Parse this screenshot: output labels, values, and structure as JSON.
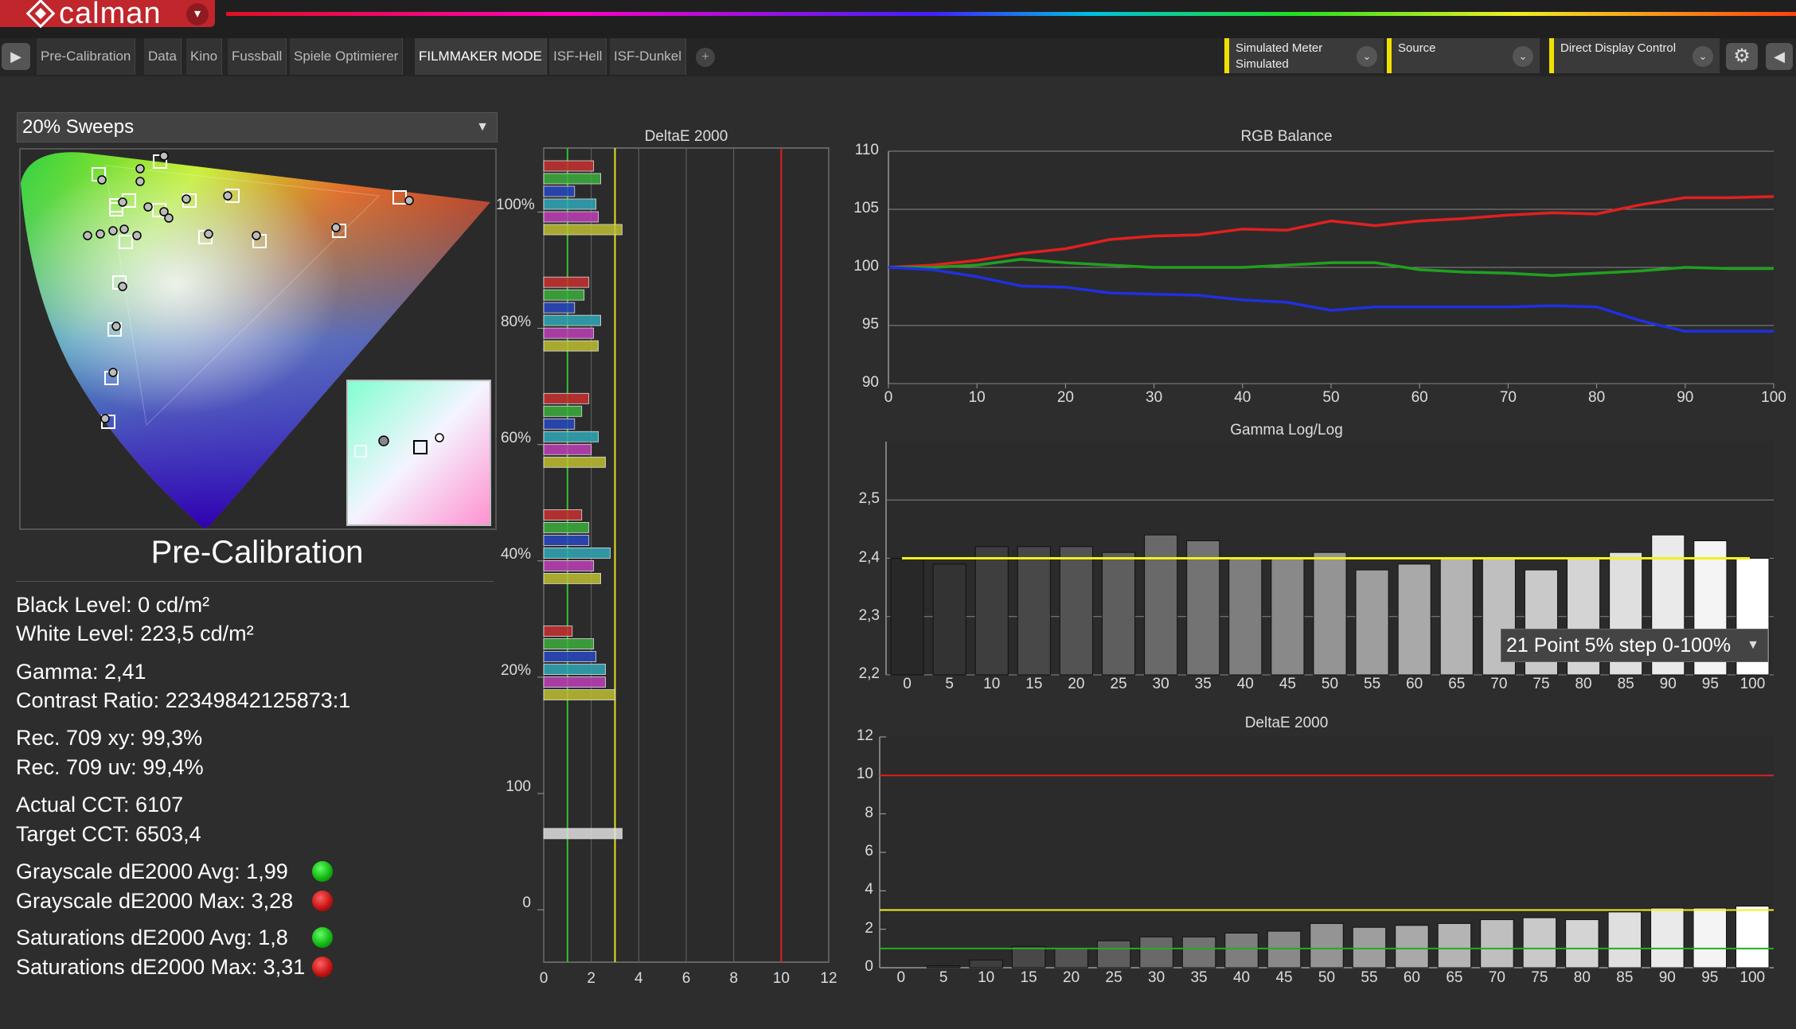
{
  "app": {
    "name": "calman",
    "logo_dropdown": "▾"
  },
  "nav": {
    "left_arrow": "▶",
    "tabs": [
      {
        "label": "Pre-Calibration",
        "active": false
      },
      {
        "label": "Data",
        "active": false
      },
      {
        "label": "Kino",
        "active": false
      },
      {
        "label": "Fussball",
        "active": false
      },
      {
        "label": "Spiele Optimierer",
        "active": false
      },
      {
        "label": "FILMMAKER MODE",
        "active": true
      },
      {
        "label": "ISF-Hell",
        "active": false
      },
      {
        "label": "ISF-Dunkel",
        "active": false
      }
    ],
    "add_tab": "+",
    "meter": {
      "line1": "Simulated Meter",
      "line2": "Simulated"
    },
    "source": {
      "line1": "Source",
      "line2": ""
    },
    "display": {
      "line1": "Direct Display Control",
      "line2": ""
    },
    "chevron": "⌄",
    "gear": "⚙",
    "back_arrow": "◀"
  },
  "left": {
    "sweep_select": "20% Sweeps",
    "caret": "▼",
    "title": "Pre-Calibration",
    "stats": {
      "black_level": "Black Level: 0 cd/m²",
      "white_level": "White Level: 223,5 cd/m²",
      "gamma": "Gamma: 2,41",
      "contrast": "Contrast Ratio: 22349842125873:1",
      "rec709_xy": "Rec. 709 xy: 99,3%",
      "rec709_uv": "Rec. 709 uv: 99,4%",
      "actual_cct": "Actual CCT: 6107",
      "target_cct": "Target CCT: 6503,4",
      "gs_avg": "Grayscale dE2000 Avg: 1,99",
      "gs_max": "Grayscale dE2000 Max: 3,28",
      "sat_avg": "Saturations dE2000 Avg: 1,8",
      "sat_max": "Saturations dE2000 Max: 3,31"
    },
    "status_colors": {
      "gs_avg": "green",
      "gs_max": "red",
      "sat_avg": "green",
      "sat_max": "red"
    }
  },
  "sat_chart": {
    "title": "DeltaE 2000",
    "groups": [
      {
        "label": "100%",
        "values": [
          2.1,
          2.4,
          1.3,
          2.2,
          2.3,
          3.3
        ]
      },
      {
        "label": "80%",
        "values": [
          1.9,
          1.7,
          1.3,
          2.4,
          2.1,
          2.3
        ]
      },
      {
        "label": "60%",
        "values": [
          1.9,
          1.6,
          1.3,
          2.3,
          2.0,
          2.6
        ]
      },
      {
        "label": "40%",
        "values": [
          1.6,
          1.9,
          1.9,
          2.8,
          2.1,
          2.4
        ]
      },
      {
        "label": "20%",
        "values": [
          1.2,
          2.1,
          2.2,
          2.6,
          2.6,
          3.0
        ]
      },
      {
        "label": "100",
        "values": [
          3.3
        ]
      },
      {
        "label": "0",
        "values": []
      }
    ],
    "bar_colors": [
      "#c83030",
      "#3cae3c",
      "#2848c0",
      "#30a8b8",
      "#c040b8",
      "#c0c030"
    ],
    "white_color": "#e0e0e0",
    "x_ticks": [
      "0",
      "2",
      "4",
      "6",
      "8",
      "10",
      "12"
    ],
    "xlim": [
      0,
      12
    ],
    "green_line": 1,
    "yellow_line": 3,
    "red_line": 10
  },
  "chart_data": [
    {
      "type": "line",
      "title": "RGB Balance",
      "x": [
        0,
        5,
        10,
        15,
        20,
        25,
        30,
        35,
        40,
        45,
        50,
        55,
        60,
        65,
        70,
        75,
        80,
        85,
        90,
        95,
        100
      ],
      "series": [
        {
          "color": "#e02020",
          "values": [
            100,
            100.2,
            100.6,
            101.2,
            101.6,
            102.4,
            102.7,
            102.8,
            103.3,
            103.2,
            104.0,
            103.6,
            104.0,
            104.2,
            104.5,
            104.7,
            104.6,
            105.4,
            106.0,
            106.0,
            106.1
          ]
        },
        {
          "color": "#20a020",
          "values": [
            100,
            100,
            100.2,
            100.7,
            100.4,
            100.2,
            100.0,
            100.0,
            100.0,
            100.2,
            100.4,
            100.4,
            99.8,
            99.6,
            99.5,
            99.3,
            99.5,
            99.7,
            100.0,
            99.9,
            99.9
          ]
        },
        {
          "color": "#2030e0",
          "values": [
            100,
            99.8,
            99.2,
            98.4,
            98.3,
            97.8,
            97.7,
            97.6,
            97.2,
            97.0,
            96.3,
            96.6,
            96.6,
            96.6,
            96.6,
            96.7,
            96.6,
            95.4,
            94.5,
            94.5,
            94.5
          ]
        }
      ],
      "ylim": [
        90,
        110
      ],
      "y_ticks": [
        "90",
        "95",
        "100",
        "105",
        "110"
      ],
      "x_ticks": [
        "0",
        "10",
        "20",
        "30",
        "40",
        "50",
        "60",
        "70",
        "80",
        "90",
        "100"
      ]
    },
    {
      "type": "bar",
      "title": "Gamma Log/Log",
      "categories": [
        "0",
        "5",
        "10",
        "15",
        "20",
        "25",
        "30",
        "35",
        "40",
        "45",
        "50",
        "55",
        "60",
        "65",
        "70",
        "75",
        "80",
        "85",
        "90",
        "95",
        "100"
      ],
      "values": [
        2.4,
        2.39,
        2.42,
        2.42,
        2.42,
        2.41,
        2.44,
        2.43,
        2.4,
        2.4,
        2.41,
        2.38,
        2.39,
        2.4,
        2.4,
        2.38,
        2.4,
        2.41,
        2.44,
        2.43,
        2.4
      ],
      "target": 2.4,
      "ylim": [
        2.2,
        2.6
      ],
      "y_ticks": [
        "2,2",
        "2,3",
        "2,4",
        "2,5"
      ],
      "range_select": "21 Point 5% step 0-100%"
    },
    {
      "type": "bar",
      "title": "DeltaE 2000",
      "categories": [
        "0",
        "5",
        "10",
        "15",
        "20",
        "25",
        "30",
        "35",
        "40",
        "45",
        "50",
        "55",
        "60",
        "65",
        "70",
        "75",
        "80",
        "85",
        "90",
        "95",
        "100"
      ],
      "values": [
        0,
        0.1,
        0.4,
        1.1,
        1.0,
        1.4,
        1.6,
        1.6,
        1.8,
        1.9,
        2.3,
        2.1,
        2.2,
        2.3,
        2.5,
        2.6,
        2.5,
        2.9,
        3.1,
        3.1,
        3.2
      ],
      "ylim": [
        0,
        12
      ],
      "y_ticks": [
        "0",
        "2",
        "4",
        "6",
        "8",
        "10",
        "12"
      ],
      "green_line": 1,
      "yellow_line": 3,
      "red_line": 10
    }
  ]
}
